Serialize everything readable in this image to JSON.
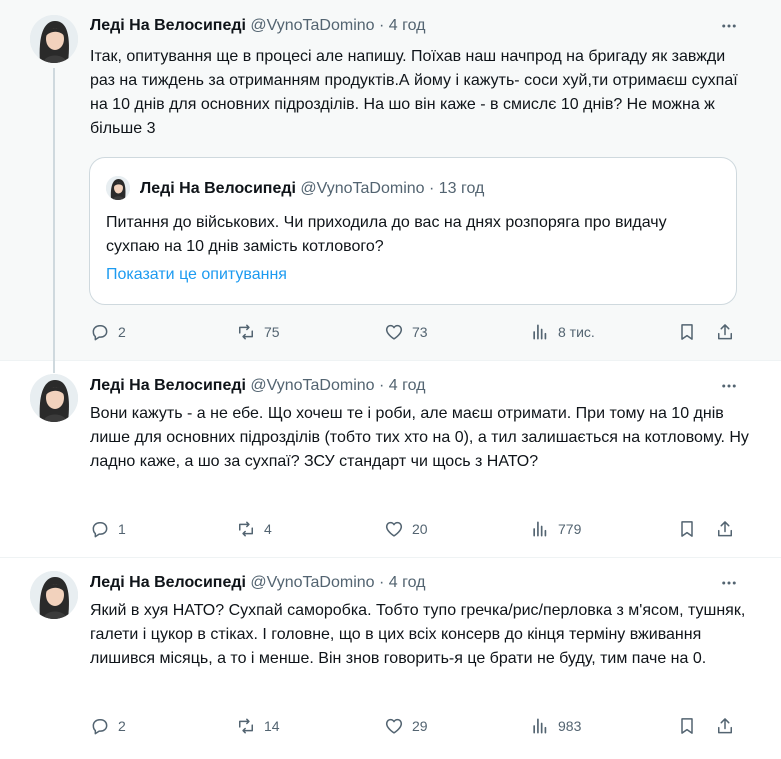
{
  "tweets": [
    {
      "name": "Леді На Велосипеді",
      "handle": "@VynoTaDomino",
      "sep": "·",
      "time": "4 год",
      "text": "Ітак, опитування ще в процесі але напишу. Поїхав наш начпрод на бригаду як завжди раз на тиждень за отриманням продуктів.А йому і кажуть- соси хуй,ти отримаєш сухпаї на 10 днів для основних підрозділів. На шо він каже - в смислє 10 днів? Не можна ж більше 3",
      "quote": {
        "name": "Леді На Велосипеді",
        "handle": "@VynoTaDomino",
        "sep": "·",
        "time": "13 год",
        "text": "Питання до військових. Чи приходила до вас на днях  розпоряга про видачу сухпаю на 10 днів замість котлового?",
        "link": "Показати це опитування"
      },
      "replies": "2",
      "reposts": "75",
      "likes": "73",
      "views": "8 тис."
    },
    {
      "name": "Леді На Велосипеді",
      "handle": "@VynoTaDomino",
      "sep": "·",
      "time": "4 год",
      "text": "Вони кажуть - а не ебе. Що хочеш те і роби, але маєш отримати. При тому на 10 днів лише для основних підрозділів (тобто тих хто на 0), а тил залишається на котловому. Ну ладно каже, а шо за сухпаї? ЗСУ стандарт чи щось з НАТО?",
      "replies": "1",
      "reposts": "4",
      "likes": "20",
      "views": "779"
    },
    {
      "name": "Леді На Велосипеді",
      "handle": "@VynoTaDomino",
      "sep": "·",
      "time": "4 год",
      "text": "Який в хуя НАТО? Сухпай саморобка. Тобто тупо гречка/рис/перловка з м'ясом, тушняк, галети і цукор в стіках. І головне, що в цих всіх консерв до кінця терміну вживання лишився місяць, а то і менше. Він знов говорить-я це брати не буду, тим паче на 0.",
      "replies": "2",
      "reposts": "14",
      "likes": "29",
      "views": "983"
    }
  ],
  "colors": {
    "text": "#0f1419",
    "secondary": "#536471",
    "link": "#1d9bf0",
    "border": "#cfd9de",
    "highlight_bg": "#f7f9f9"
  },
  "icons": [
    "avatar",
    "more-icon",
    "reply-icon",
    "repost-icon",
    "like-icon",
    "views-icon",
    "bookmark-icon",
    "share-icon"
  ]
}
